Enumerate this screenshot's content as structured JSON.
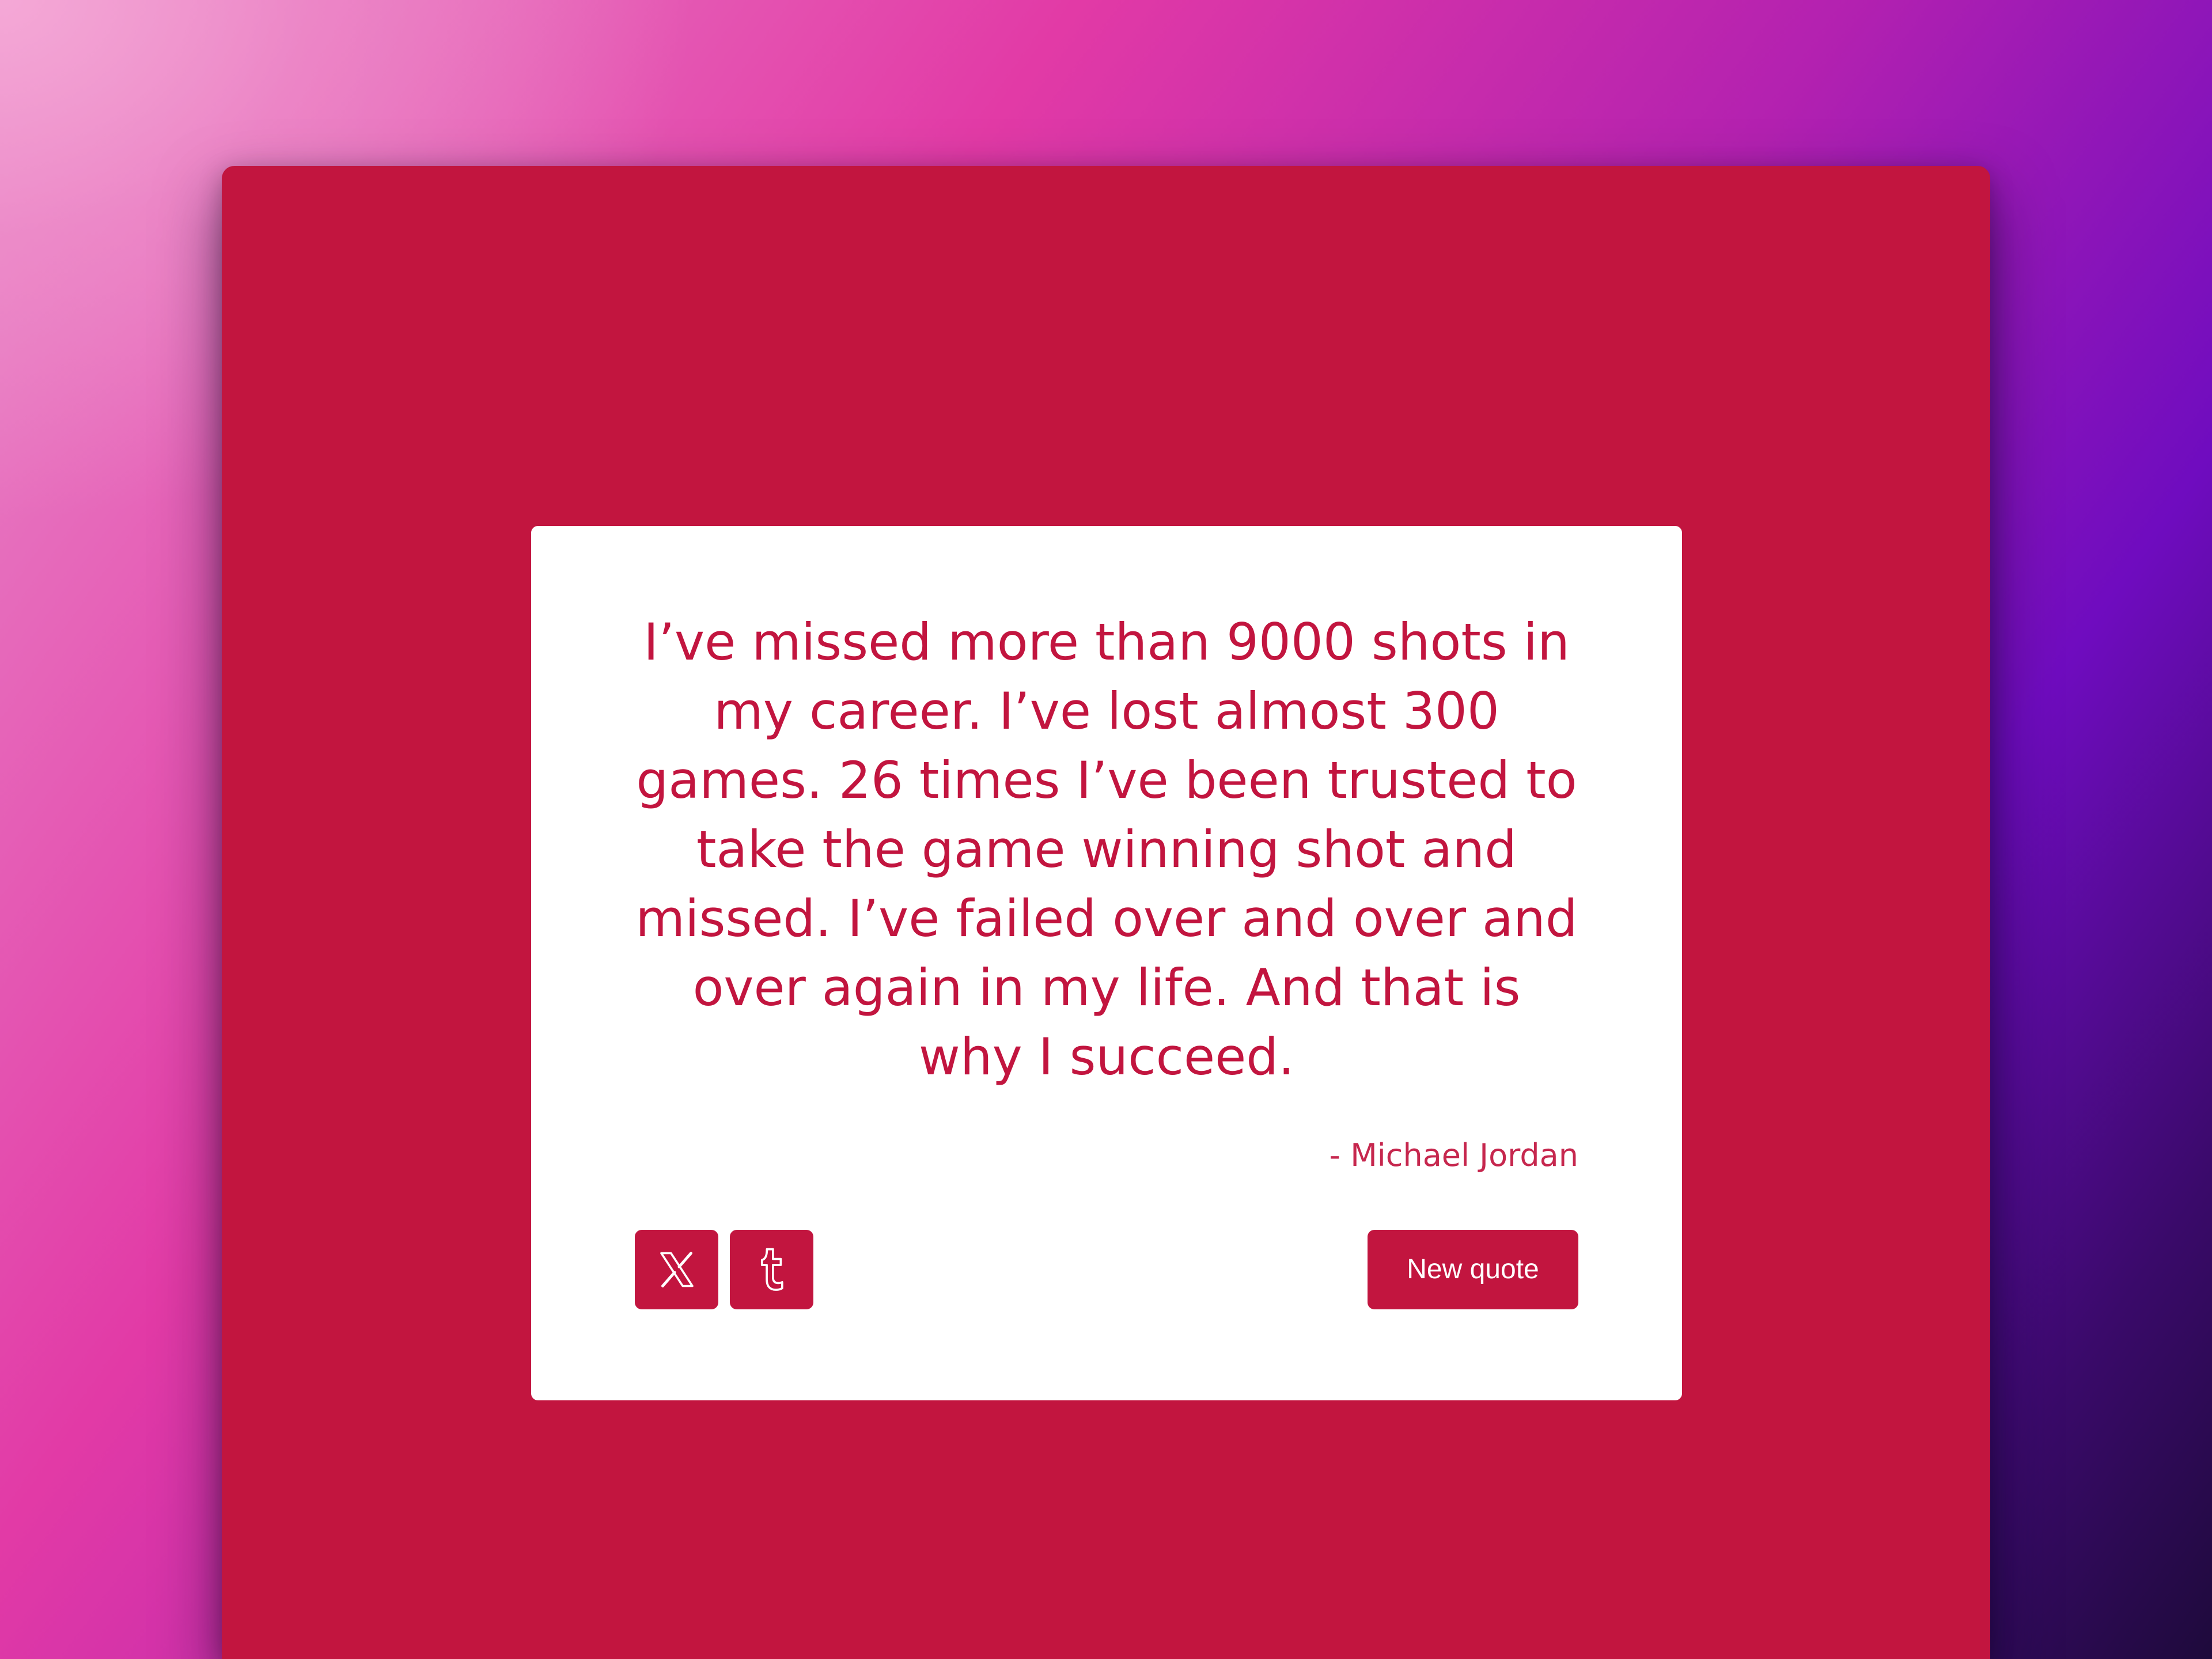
{
  "theme": {
    "accent_color": "#c2153f",
    "card_color": "#ffffff",
    "button_text_color": "#ffffff"
  },
  "quote": {
    "text": "I’ve missed more than 9000 shots in my career. I’ve lost almost 300 games. 26 times I’ve been trusted to take the game winning shot and missed. I’ve failed over and over and over again in my life. And that is why I succeed.",
    "author": "- Michael Jordan"
  },
  "actions": {
    "twitter_icon": "x-logo-icon",
    "tumblr_icon": "tumblr-logo-icon",
    "new_quote_label": "New quote"
  }
}
